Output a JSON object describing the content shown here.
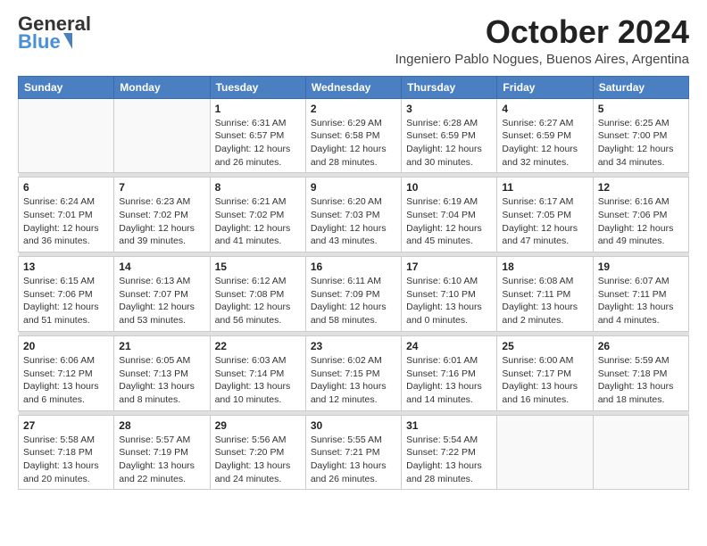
{
  "header": {
    "logo_line1": "General",
    "logo_line2": "Blue",
    "month": "October 2024",
    "location": "Ingeniero Pablo Nogues, Buenos Aires, Argentina"
  },
  "weekdays": [
    "Sunday",
    "Monday",
    "Tuesday",
    "Wednesday",
    "Thursday",
    "Friday",
    "Saturday"
  ],
  "weeks": [
    [
      {
        "day": "",
        "info": ""
      },
      {
        "day": "",
        "info": ""
      },
      {
        "day": "1",
        "info": "Sunrise: 6:31 AM\nSunset: 6:57 PM\nDaylight: 12 hours\nand 26 minutes."
      },
      {
        "day": "2",
        "info": "Sunrise: 6:29 AM\nSunset: 6:58 PM\nDaylight: 12 hours\nand 28 minutes."
      },
      {
        "day": "3",
        "info": "Sunrise: 6:28 AM\nSunset: 6:59 PM\nDaylight: 12 hours\nand 30 minutes."
      },
      {
        "day": "4",
        "info": "Sunrise: 6:27 AM\nSunset: 6:59 PM\nDaylight: 12 hours\nand 32 minutes."
      },
      {
        "day": "5",
        "info": "Sunrise: 6:25 AM\nSunset: 7:00 PM\nDaylight: 12 hours\nand 34 minutes."
      }
    ],
    [
      {
        "day": "6",
        "info": "Sunrise: 6:24 AM\nSunset: 7:01 PM\nDaylight: 12 hours\nand 36 minutes."
      },
      {
        "day": "7",
        "info": "Sunrise: 6:23 AM\nSunset: 7:02 PM\nDaylight: 12 hours\nand 39 minutes."
      },
      {
        "day": "8",
        "info": "Sunrise: 6:21 AM\nSunset: 7:02 PM\nDaylight: 12 hours\nand 41 minutes."
      },
      {
        "day": "9",
        "info": "Sunrise: 6:20 AM\nSunset: 7:03 PM\nDaylight: 12 hours\nand 43 minutes."
      },
      {
        "day": "10",
        "info": "Sunrise: 6:19 AM\nSunset: 7:04 PM\nDaylight: 12 hours\nand 45 minutes."
      },
      {
        "day": "11",
        "info": "Sunrise: 6:17 AM\nSunset: 7:05 PM\nDaylight: 12 hours\nand 47 minutes."
      },
      {
        "day": "12",
        "info": "Sunrise: 6:16 AM\nSunset: 7:06 PM\nDaylight: 12 hours\nand 49 minutes."
      }
    ],
    [
      {
        "day": "13",
        "info": "Sunrise: 6:15 AM\nSunset: 7:06 PM\nDaylight: 12 hours\nand 51 minutes."
      },
      {
        "day": "14",
        "info": "Sunrise: 6:13 AM\nSunset: 7:07 PM\nDaylight: 12 hours\nand 53 minutes."
      },
      {
        "day": "15",
        "info": "Sunrise: 6:12 AM\nSunset: 7:08 PM\nDaylight: 12 hours\nand 56 minutes."
      },
      {
        "day": "16",
        "info": "Sunrise: 6:11 AM\nSunset: 7:09 PM\nDaylight: 12 hours\nand 58 minutes."
      },
      {
        "day": "17",
        "info": "Sunrise: 6:10 AM\nSunset: 7:10 PM\nDaylight: 13 hours\nand 0 minutes."
      },
      {
        "day": "18",
        "info": "Sunrise: 6:08 AM\nSunset: 7:11 PM\nDaylight: 13 hours\nand 2 minutes."
      },
      {
        "day": "19",
        "info": "Sunrise: 6:07 AM\nSunset: 7:11 PM\nDaylight: 13 hours\nand 4 minutes."
      }
    ],
    [
      {
        "day": "20",
        "info": "Sunrise: 6:06 AM\nSunset: 7:12 PM\nDaylight: 13 hours\nand 6 minutes."
      },
      {
        "day": "21",
        "info": "Sunrise: 6:05 AM\nSunset: 7:13 PM\nDaylight: 13 hours\nand 8 minutes."
      },
      {
        "day": "22",
        "info": "Sunrise: 6:03 AM\nSunset: 7:14 PM\nDaylight: 13 hours\nand 10 minutes."
      },
      {
        "day": "23",
        "info": "Sunrise: 6:02 AM\nSunset: 7:15 PM\nDaylight: 13 hours\nand 12 minutes."
      },
      {
        "day": "24",
        "info": "Sunrise: 6:01 AM\nSunset: 7:16 PM\nDaylight: 13 hours\nand 14 minutes."
      },
      {
        "day": "25",
        "info": "Sunrise: 6:00 AM\nSunset: 7:17 PM\nDaylight: 13 hours\nand 16 minutes."
      },
      {
        "day": "26",
        "info": "Sunrise: 5:59 AM\nSunset: 7:18 PM\nDaylight: 13 hours\nand 18 minutes."
      }
    ],
    [
      {
        "day": "27",
        "info": "Sunrise: 5:58 AM\nSunset: 7:18 PM\nDaylight: 13 hours\nand 20 minutes."
      },
      {
        "day": "28",
        "info": "Sunrise: 5:57 AM\nSunset: 7:19 PM\nDaylight: 13 hours\nand 22 minutes."
      },
      {
        "day": "29",
        "info": "Sunrise: 5:56 AM\nSunset: 7:20 PM\nDaylight: 13 hours\nand 24 minutes."
      },
      {
        "day": "30",
        "info": "Sunrise: 5:55 AM\nSunset: 7:21 PM\nDaylight: 13 hours\nand 26 minutes."
      },
      {
        "day": "31",
        "info": "Sunrise: 5:54 AM\nSunset: 7:22 PM\nDaylight: 13 hours\nand 28 minutes."
      },
      {
        "day": "",
        "info": ""
      },
      {
        "day": "",
        "info": ""
      }
    ]
  ]
}
